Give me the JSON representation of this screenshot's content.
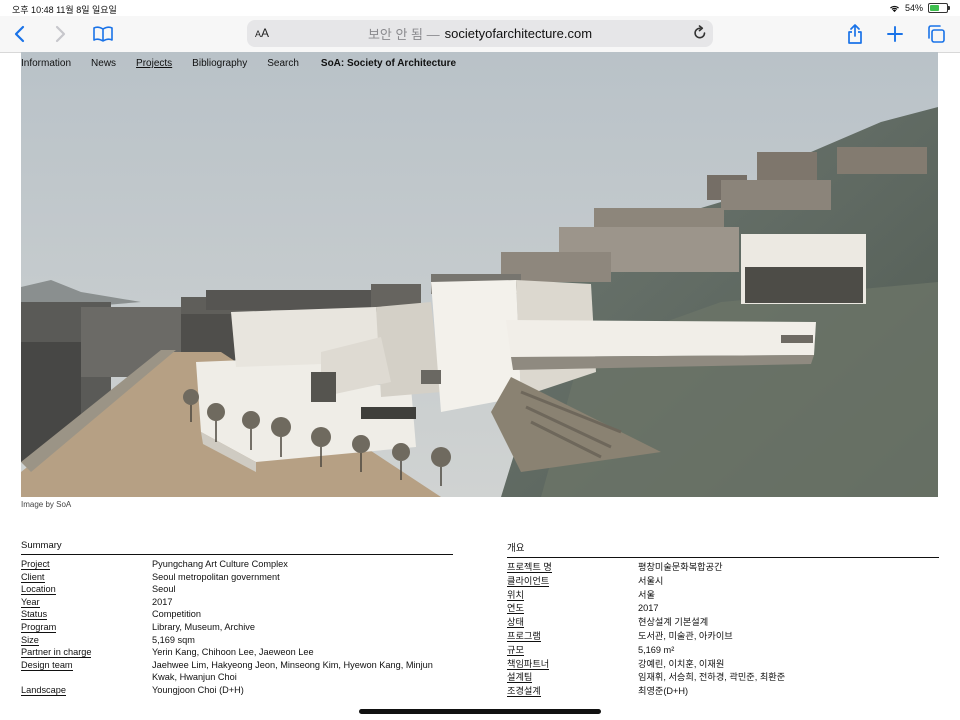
{
  "status_bar": {
    "time_date": "오후 10:48   11월 8일 일요일",
    "battery_text": "54%",
    "battery_level": 0.54
  },
  "browser": {
    "text_size_label": "AA",
    "security_label": "보안 안 됨 —",
    "domain": "societyofarchitecture.com",
    "icons": [
      "back-icon",
      "forward-icon",
      "bookmarks-icon",
      "reload-icon",
      "share-icon",
      "add-tab-icon",
      "tabs-icon"
    ]
  },
  "site_nav": {
    "items": [
      "Information",
      "News",
      "Projects",
      "Bibliography",
      "Search"
    ],
    "active": "Projects",
    "brand": "SoA: Society of Architecture"
  },
  "image": {
    "caption": "Image by SoA"
  },
  "summary_en": {
    "heading": "Summary",
    "rows": [
      {
        "key": "Project",
        "value": "Pyungchang Art Culture Complex"
      },
      {
        "key": "Client",
        "value": "Seoul metropolitan government"
      },
      {
        "key": "Location",
        "value": "Seoul"
      },
      {
        "key": "Year",
        "value": "2017"
      },
      {
        "key": "Status",
        "value": "Competition"
      },
      {
        "key": "Program",
        "value": "Library, Museum, Archive"
      },
      {
        "key": "Size",
        "value": "5,169 sqm"
      },
      {
        "key": "Partner in charge",
        "value": "Yerin Kang, Chihoon Lee, Jaeweon Lee"
      },
      {
        "key": "Design team",
        "value": "Jaehwee Lim, Hakyeong Jeon, Minseong Kim, Hyewon Kang, Minjun Kwak, Hwanjun Choi"
      },
      {
        "key": "Landscape",
        "value": "Youngjoon Choi (D+H)"
      }
    ]
  },
  "summary_ko": {
    "heading": "개요",
    "rows": [
      {
        "key": "프로젝트 명",
        "value": "평창미술문화복합공간"
      },
      {
        "key": "클라이언트",
        "value": "서울시"
      },
      {
        "key": "위치",
        "value": "서울"
      },
      {
        "key": "연도",
        "value": "2017"
      },
      {
        "key": "상태",
        "value": "현상설계 기본설계"
      },
      {
        "key": "프로그램",
        "value": "도서관, 미술관, 아카이브"
      },
      {
        "key": "규모",
        "value": "5,169 m²"
      },
      {
        "key": "책임파트너",
        "value": "강예린, 이치훈, 이재원"
      },
      {
        "key": "설계팀",
        "value": "임재휘, 서승희, 전하경, 곽민준, 최환준"
      },
      {
        "key": "조경설계",
        "value": "최영준(D+H)"
      }
    ]
  },
  "colors": {
    "link_blue": "#1a73e8",
    "toolbar_bg": "#f7f7f7",
    "address_bg": "#e6e6e8",
    "battery_green": "#3fbf4f"
  }
}
